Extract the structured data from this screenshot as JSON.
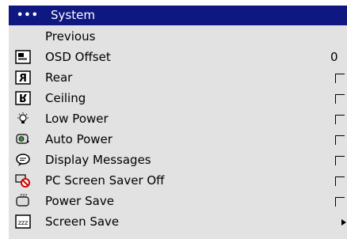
{
  "menu": {
    "header": {
      "dots": "•••",
      "title": "System"
    },
    "items": [
      {
        "label": "Previous",
        "icon": "none",
        "control": "none"
      },
      {
        "label": "OSD Offset",
        "icon": "osd-offset-icon",
        "control": "value",
        "value": "0"
      },
      {
        "label": "Rear",
        "icon": "rear-projection-icon",
        "control": "checkbox",
        "checked": false
      },
      {
        "label": "Ceiling",
        "icon": "ceiling-mount-icon",
        "control": "checkbox",
        "checked": false
      },
      {
        "label": "Low Power",
        "icon": "lamp-icon",
        "control": "checkbox",
        "checked": false
      },
      {
        "label": "Auto Power",
        "icon": "auto-power-icon",
        "control": "checkbox",
        "checked": false
      },
      {
        "label": "Display Messages",
        "icon": "speech-bubble-icon",
        "control": "checkbox",
        "checked": false
      },
      {
        "label": "PC Screen Saver Off",
        "icon": "screen-saver-off-icon",
        "control": "checkbox",
        "checked": false
      },
      {
        "label": "Power Save",
        "icon": "power-save-icon",
        "control": "checkbox",
        "checked": false
      },
      {
        "label": "Screen Save",
        "icon": "screen-save-icon",
        "control": "submenu"
      }
    ]
  }
}
